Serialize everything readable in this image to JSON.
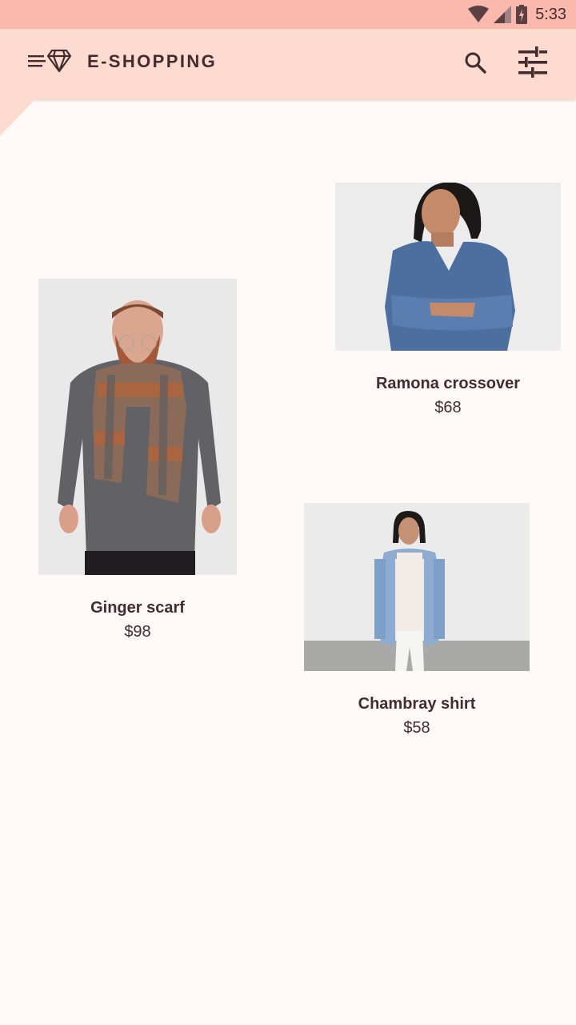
{
  "status_bar": {
    "time": "5:33"
  },
  "app_bar": {
    "title": "E-SHOPPING",
    "icons": [
      "menu-icon",
      "diamond-logo-icon",
      "search-icon",
      "tune-icon"
    ]
  },
  "products": [
    {
      "name": "Ginger scarf",
      "price": "$98"
    },
    {
      "name": "Ramona crossover",
      "price": "$68"
    },
    {
      "name": "Chambray shirt",
      "price": "$58"
    }
  ],
  "colors": {
    "primary": "#fedbd0",
    "status_bar": "#fbb8ac",
    "background": "#fffaf8",
    "text": "#442c2e"
  }
}
